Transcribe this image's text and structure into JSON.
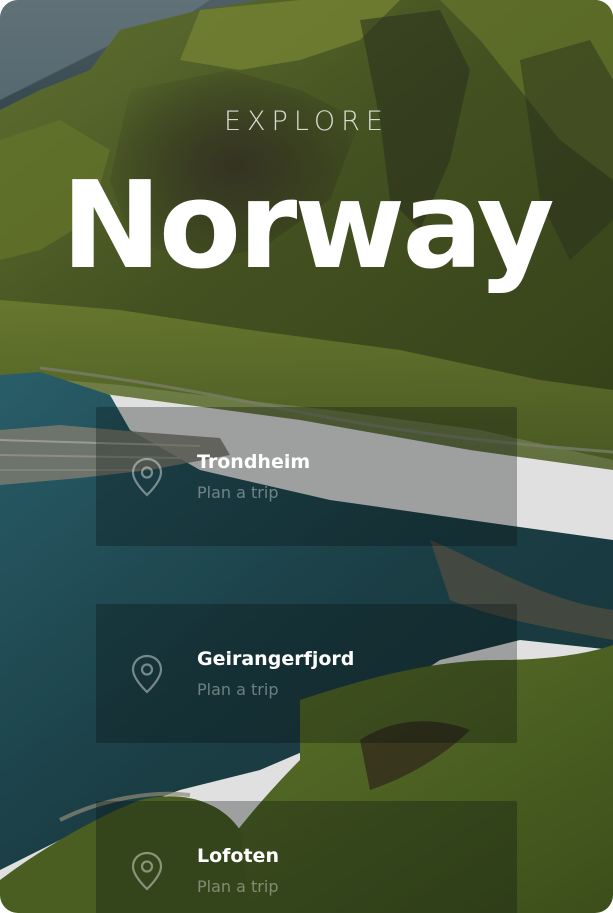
{
  "header": {
    "eyebrow": "EXPLORE",
    "title": "Norway"
  },
  "destinations": [
    {
      "name": "Trondheim",
      "action_label": "Plan a trip",
      "icon": "map-pin-icon"
    },
    {
      "name": "Geirangerfjord",
      "action_label": "Plan a trip",
      "icon": "map-pin-icon"
    },
    {
      "name": "Lofoten",
      "action_label": "Plan a trip",
      "icon": "map-pin-icon"
    }
  ],
  "colors": {
    "text_primary": "#ffffff",
    "card_overlay": "rgba(8,12,14,0.30)",
    "mountain_green": "#5f7830",
    "water_teal": "#24505a"
  }
}
